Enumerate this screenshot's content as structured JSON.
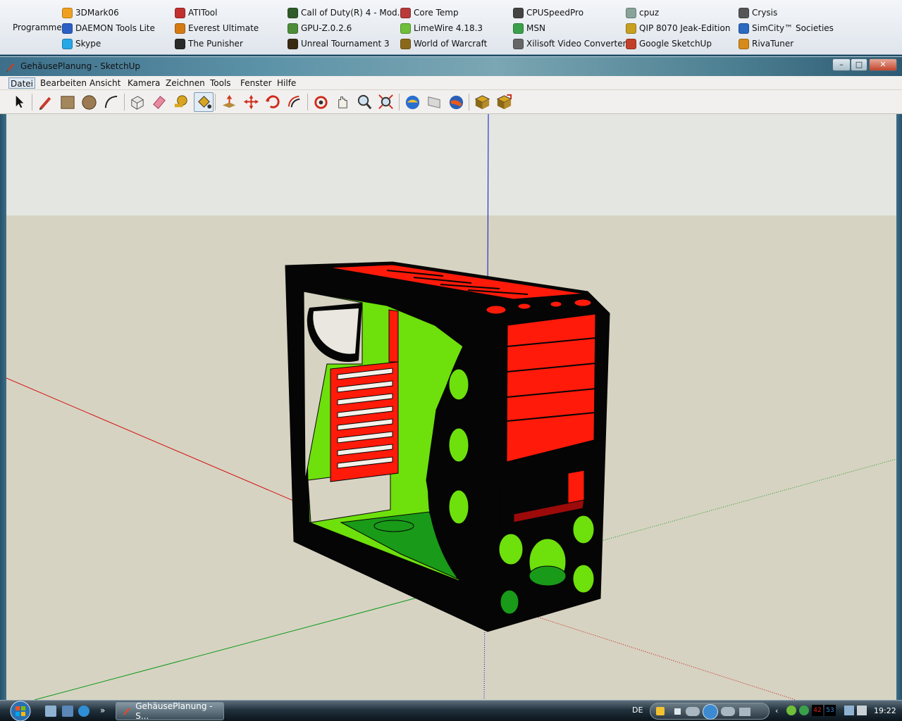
{
  "launcher": {
    "label": "Programme",
    "items": [
      {
        "label": "3DMark06",
        "icon": "3dmark-icon",
        "color": "#f0a020"
      },
      {
        "label": "DAEMON Tools Lite",
        "icon": "daemon-tools-icon",
        "color": "#2b5fc4"
      },
      {
        "label": "Skype",
        "icon": "skype-icon",
        "color": "#27a7e6"
      },
      {
        "label": "ATITool",
        "icon": "atitool-icon",
        "color": "#c23030"
      },
      {
        "label": "Everest Ultimate",
        "icon": "everest-icon",
        "color": "#d57a12"
      },
      {
        "label": "The Punisher",
        "icon": "punisher-icon",
        "color": "#2a2a2a"
      },
      {
        "label": "Call of Duty(R) 4 - Mod...",
        "icon": "cod4-icon",
        "color": "#2f5c2a"
      },
      {
        "label": "GPU-Z.0.2.6",
        "icon": "gpuz-icon",
        "color": "#4d8d3a"
      },
      {
        "label": "Unreal Tournament 3",
        "icon": "ut3-icon",
        "color": "#3a2a14"
      },
      {
        "label": "Core Temp",
        "icon": "core-temp-icon",
        "color": "#b83a3a"
      },
      {
        "label": "LimeWire 4.18.3",
        "icon": "limewire-icon",
        "color": "#6fbf3a"
      },
      {
        "label": "World of Warcraft",
        "icon": "wow-icon",
        "color": "#8a6a1a"
      },
      {
        "label": "CPUSpeedPro",
        "icon": "cpuspeed-icon",
        "color": "#444444"
      },
      {
        "label": "MSN",
        "icon": "msn-icon",
        "color": "#3aa04a"
      },
      {
        "label": "Xilisoft Video Converter...",
        "icon": "xilisoft-icon",
        "color": "#666666"
      },
      {
        "label": "cpuz",
        "icon": "cpuz-icon",
        "color": "#8aa39a"
      },
      {
        "label": "QIP 8070 Jeak-Edition",
        "icon": "qip-icon",
        "color": "#c8a020"
      },
      {
        "label": "Google SketchUp",
        "icon": "sketchup-icon",
        "color": "#c2402a"
      },
      {
        "label": "Crysis",
        "icon": "crysis-icon",
        "color": "#555555"
      },
      {
        "label": "SimCity™ Societies",
        "icon": "simcity-icon",
        "color": "#2a6ac0"
      },
      {
        "label": "RivaTuner",
        "icon": "rivatuner-icon",
        "color": "#d58a1a"
      }
    ]
  },
  "window": {
    "title": "GehäusePlanung - SketchUp",
    "controls": {
      "minimize": "–",
      "maximize": "□",
      "close": "✕"
    }
  },
  "menus": [
    "Datei",
    "Bearbeiten",
    "Ansicht",
    "Kamera",
    "Zeichnen",
    "Tools",
    "Fenster",
    "Hilfe"
  ],
  "tools": [
    {
      "name": "select-tool-icon",
      "active": false
    },
    {
      "name": "pencil-tool-icon",
      "active": false
    },
    {
      "name": "rectangle-tool-icon",
      "active": false
    },
    {
      "name": "circle-tool-icon",
      "active": false
    },
    {
      "name": "arc-tool-icon",
      "active": false
    },
    {
      "name": "make-component-icon",
      "active": false
    },
    {
      "name": "eraser-tool-icon",
      "active": false
    },
    {
      "name": "tape-measure-icon",
      "active": false
    },
    {
      "name": "paint-bucket-icon",
      "active": true
    },
    {
      "name": "push-pull-icon",
      "active": false
    },
    {
      "name": "move-tool-icon",
      "active": false
    },
    {
      "name": "rotate-tool-icon",
      "active": false
    },
    {
      "name": "offset-tool-icon",
      "active": false
    },
    {
      "name": "orbit-tool-icon",
      "active": false
    },
    {
      "name": "pan-tool-icon",
      "active": false
    },
    {
      "name": "zoom-tool-icon",
      "active": false
    },
    {
      "name": "zoom-extents-icon",
      "active": false
    },
    {
      "name": "get-models-icon",
      "active": false
    },
    {
      "name": "share-model-icon",
      "active": false
    },
    {
      "name": "google-earth-icon",
      "active": false
    },
    {
      "name": "get-components-icon",
      "active": false
    },
    {
      "name": "share-component-icon",
      "active": false
    }
  ],
  "colors": {
    "case_black": "#050505",
    "case_red": "#ff1a0a",
    "case_dark_red": "#9c0a0a",
    "case_green": "#6ee00c",
    "case_dark_green": "#199a18",
    "sky": "#e4e6e1",
    "ground": "#d7d3c2"
  },
  "taskbar": {
    "task_label": "GehäusePlanung - S...",
    "language": "DE",
    "tray_temp_1": "42",
    "tray_temp_2": "53",
    "clock": "19:22"
  }
}
